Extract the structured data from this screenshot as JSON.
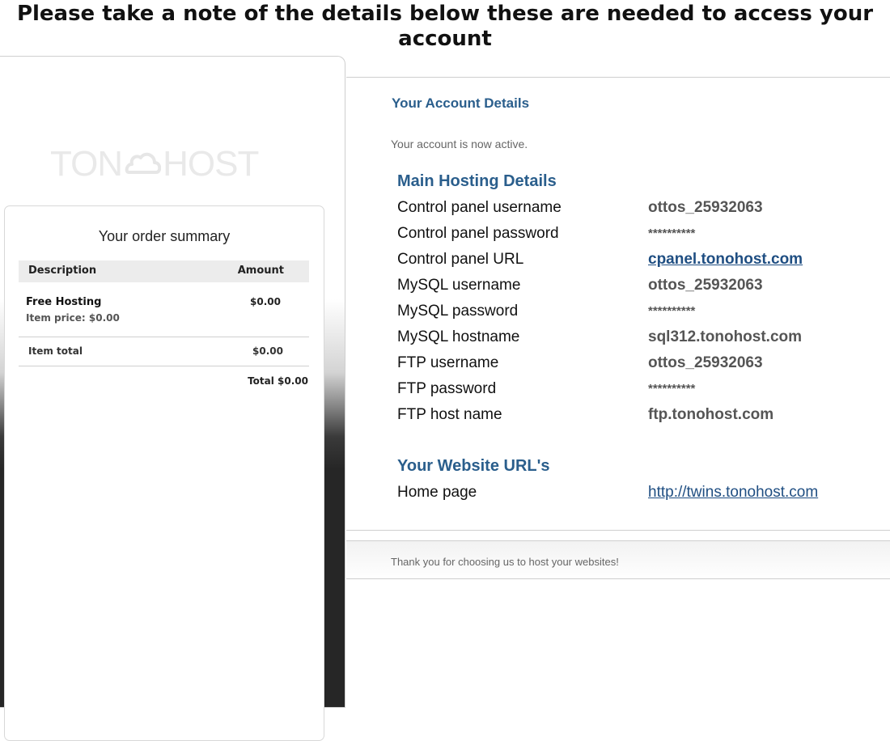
{
  "notice": "Please take a note of the details below these are needed to access your account",
  "logo": {
    "left": "TON",
    "right": "HOST",
    "icon": "cloud-icon"
  },
  "order": {
    "title": "Your order summary",
    "col_description": "Description",
    "col_amount": "Amount",
    "item_name": "Free Hosting",
    "item_price": "Item price: $0.00",
    "item_amount": "$0.00",
    "item_total_label": "Item total",
    "item_total_amount": "$0.00",
    "grand_total": "Total $0.00"
  },
  "account": {
    "title": "Your Account Details",
    "status": "Your account is now active.",
    "main_heading": "Main Hosting Details",
    "details": [
      {
        "label": "Control panel username",
        "value": "ottos_25932063"
      },
      {
        "label": "Control panel password",
        "value": "**********"
      },
      {
        "label": "Control panel URL",
        "value": "cpanel.tonohost.com"
      },
      {
        "label": "MySQL username",
        "value": "ottos_25932063"
      },
      {
        "label": "MySQL password",
        "value": "**********"
      },
      {
        "label": "MySQL hostname",
        "value": "sql312.tonohost.com"
      },
      {
        "label": "FTP username",
        "value": "ottos_25932063"
      },
      {
        "label": "FTP password",
        "value": "**********"
      },
      {
        "label": "FTP host name",
        "value": "ftp.tonohost.com"
      }
    ],
    "urls_heading": "Your Website URL's",
    "home_label": "Home page",
    "home_url": "http://twins.tonohost.com"
  },
  "footer": "Thank you for choosing us to host your websites!",
  "colors": {
    "accent": "#2a5e8c",
    "link": "#1f4e82"
  }
}
